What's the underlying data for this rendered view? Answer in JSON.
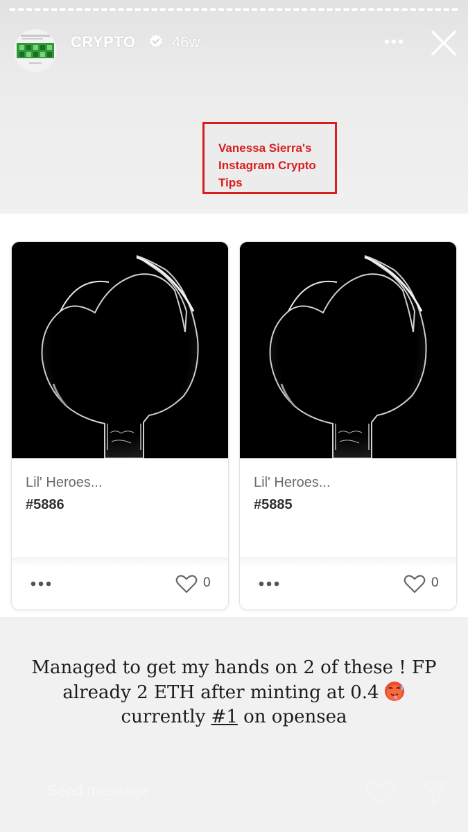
{
  "story": {
    "username": "CRYPTO",
    "time_ago": "46w",
    "icons": {
      "verified": "verified-badge-icon",
      "more": "more-options-icon",
      "close": "close-icon"
    }
  },
  "watermark": {
    "text": "Vanessa Sierra's\nInstagram Crypto\nTips",
    "color": "#d81e1e"
  },
  "cards": [
    {
      "collection": "Lil' Heroes...",
      "token": "#5886",
      "likes": "0"
    },
    {
      "collection": "Lil' Heroes...",
      "token": "#5885",
      "likes": "0"
    }
  ],
  "caption": {
    "line1": "Managed to get my hands on 2 of these ! FP",
    "line2": "already 2 ETH after minting at 0.4",
    "line3_before": "currently ",
    "line3_link": "#1",
    "line3_after": " on opensea"
  },
  "reply": {
    "placeholder": "Send message"
  }
}
